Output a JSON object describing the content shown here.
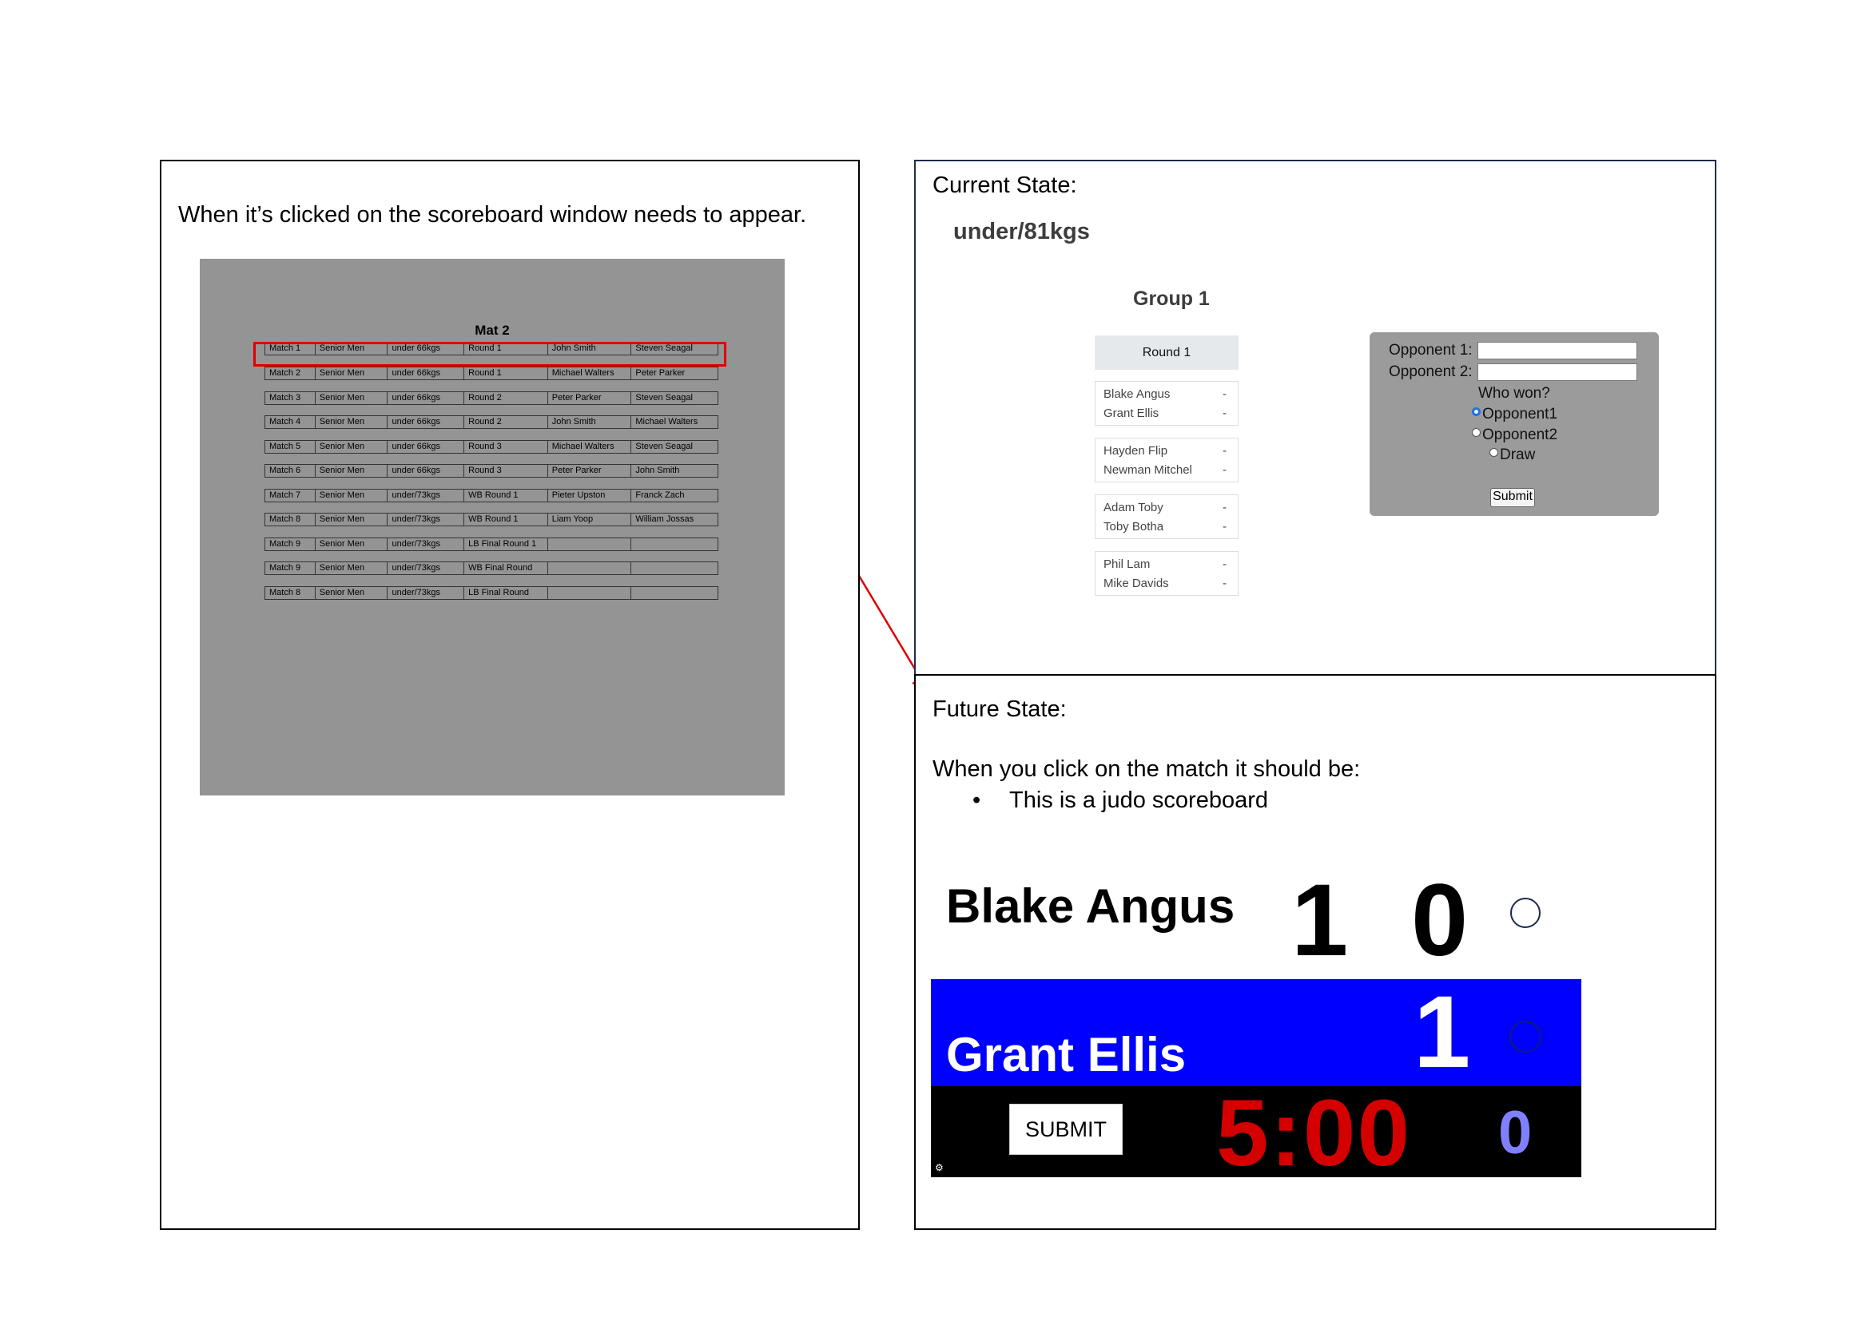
{
  "left": {
    "instruction": "When it’s clicked on the scoreboard window needs to appear.",
    "mat": {
      "title": "Mat 2",
      "rows": [
        [
          "Match 1",
          "Senior Men",
          "under 66kgs",
          "Round 1",
          "John Smith",
          "Steven Seagal"
        ],
        [
          "Match 2",
          "Senior Men",
          "under 66kgs",
          "Round 1",
          "Michael Walters",
          "Peter Parker"
        ],
        [
          "Match 3",
          "Senior Men",
          "under 66kgs",
          "Round 2",
          "Peter Parker",
          "Steven Seagal"
        ],
        [
          "Match 4",
          "Senior Men",
          "under 66kgs",
          "Round 2",
          "John Smith",
          "Michael Walters"
        ],
        [
          "Match 5",
          "Senior Men",
          "under 66kgs",
          "Round 3",
          "Michael Walters",
          "Steven Seagal"
        ],
        [
          "Match 6",
          "Senior Men",
          "under 66kgs",
          "Round 3",
          "Peter Parker",
          "John Smith"
        ],
        [
          "Match 7",
          "Senior Men",
          "under/73kgs",
          "WB Round 1",
          "Pieter Upston",
          "Franck Zach"
        ],
        [
          "Match 8",
          "Senior Men",
          "under/73kgs",
          "WB Round 1",
          "Liam Yoop",
          "William Jossas"
        ],
        [
          "Match 9",
          "Senior Men",
          "under/73kgs",
          "LB Final Round 1",
          "",
          ""
        ],
        [
          "Match 9",
          "Senior Men",
          "under/73kgs",
          "WB Final Round",
          "",
          ""
        ],
        [
          "Match 8",
          "Senior Men",
          "under/73kgs",
          "LB Final Round",
          "",
          ""
        ]
      ]
    }
  },
  "current": {
    "heading": "Current State:",
    "weight": "under/81kgs",
    "group": "Group 1",
    "round": "Round 1",
    "matches": [
      [
        {
          "name": "Blake Angus",
          "score": "-"
        },
        {
          "name": "Grant Ellis",
          "score": "-"
        }
      ],
      [
        {
          "name": "Hayden Flip",
          "score": "-"
        },
        {
          "name": "Newman Mitchel",
          "score": "-"
        }
      ],
      [
        {
          "name": "Adam Toby",
          "score": "-"
        },
        {
          "name": "Toby Botha",
          "score": "-"
        }
      ],
      [
        {
          "name": "Phil Lam",
          "score": "-"
        },
        {
          "name": "Mike Davids",
          "score": "-"
        }
      ]
    ],
    "form": {
      "opponent1_label": "Opponent 1:",
      "opponent2_label": "Opponent 2:",
      "question": "Who won?",
      "options": [
        "Opponent1",
        "Opponent2",
        "Draw"
      ],
      "selected": "Opponent1",
      "submit": "Submit"
    }
  },
  "future": {
    "heading": "Future State:",
    "intro": "When you click on the match it should be:",
    "bullet": "This is a judo scoreboard",
    "scoreboard": {
      "white_name": "Blake Angus",
      "white_score_1": "1",
      "white_score_2": "0",
      "blue_name": "Grant Ellis",
      "blue_score": "1",
      "submit": "SUBMIT",
      "timer": "5:00",
      "penalty": "0",
      "colors": {
        "blue": "#0000ff",
        "timer": "#d40000",
        "penalty": "#8080ff"
      },
      "settings_icon": "gear-icon"
    }
  },
  "annotation_color": "#e00000"
}
